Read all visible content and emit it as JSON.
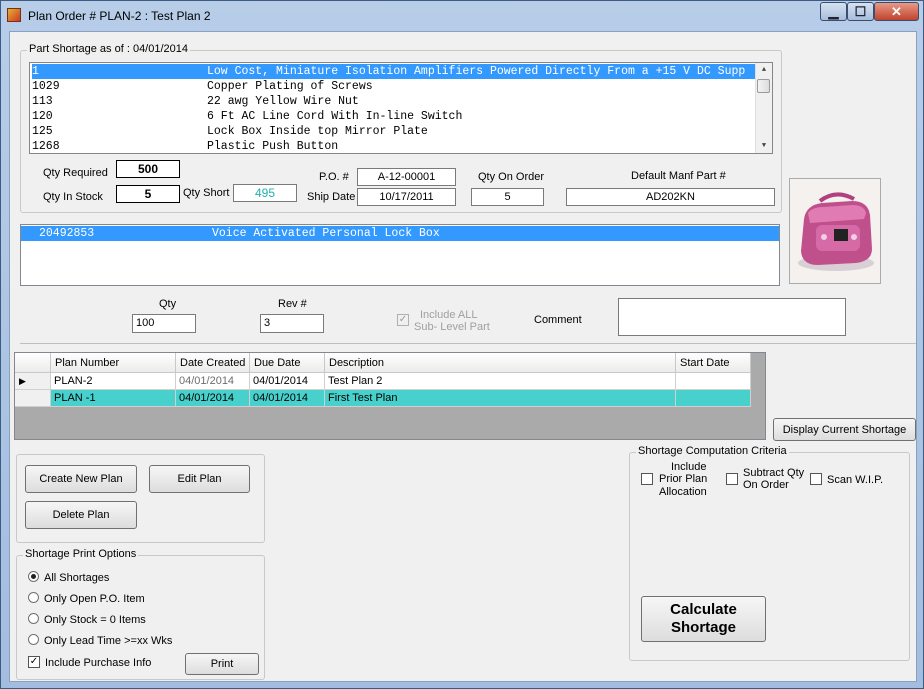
{
  "window": {
    "title": "Plan Order # PLAN-2 : Test Plan 2",
    "min_label": "▁",
    "max_label": "☐",
    "close_label": "✕"
  },
  "shortage_group": {
    "legend": "Part Shortage as of : 04/01/2014",
    "parts": [
      {
        "id": "1",
        "desc": "Low Cost, Miniature Isolation Amplifiers Powered Directly From a +15 V DC Supp",
        "selected": true
      },
      {
        "id": "1029",
        "desc": "Copper Plating of Screws",
        "selected": false
      },
      {
        "id": "113",
        "desc": "22 awg Yellow Wire Nut",
        "selected": false
      },
      {
        "id": "120",
        "desc": "6 Ft AC Line Cord With In-line Switch",
        "selected": false
      },
      {
        "id": "125",
        "desc": "Lock Box Inside top Mirror Plate",
        "selected": false
      },
      {
        "id": "1268",
        "desc": "Plastic Push Button",
        "selected": false
      }
    ],
    "qty_required_label": "Qty Required",
    "qty_required": "500",
    "qty_in_stock_label": "Qty In Stock",
    "qty_in_stock": "5",
    "qty_short_label": "Qty Short",
    "qty_short": "495",
    "po_label": "P.O. #",
    "po_value": "A-12-00001",
    "ship_date_label": "Ship Date",
    "ship_date": "10/17/2011",
    "qty_on_order_label": "Qty On Order",
    "qty_on_order": "5",
    "manf_part_label": "Default Manf Part #",
    "manf_part": "AD202KN"
  },
  "assembly_list": {
    "items": [
      {
        "id": "20492853",
        "desc": "Voice Activated Personal  Lock Box",
        "selected": true
      }
    ]
  },
  "plan_inputs": {
    "qty_label": "Qty",
    "qty_value": "100",
    "rev_label": "Rev #",
    "rev_value": "3",
    "include_all_label_1": "Include ALL",
    "include_all_label_2": "Sub- Level Part",
    "comment_label": "Comment",
    "comment_value": ""
  },
  "plans_grid": {
    "columns": [
      "Plan Number",
      "Date Created",
      "Due Date",
      "Description",
      "Start Date"
    ],
    "rows": [
      {
        "plan": "PLAN-2",
        "created": "04/01/2014",
        "due": "04/01/2014",
        "desc": "Test Plan 2",
        "start": "",
        "current": true,
        "selected": false
      },
      {
        "plan": "PLAN -1",
        "created": "04/01/2014",
        "due": "04/01/2014",
        "desc": "First Test Plan",
        "start": "",
        "current": false,
        "selected": true
      }
    ],
    "row_marker": "▶"
  },
  "buttons": {
    "display_current_shortage": "Display Current Shortage",
    "create_new_plan": "Create New  Plan",
    "edit_plan": "Edit Plan",
    "delete_plan": "Delete Plan",
    "print": "Print",
    "calculate_1": "Calculate",
    "calculate_2": "Shortage"
  },
  "print_options": {
    "legend": "Shortage Print Options",
    "options": [
      {
        "label": "All Shortages",
        "selected": true
      },
      {
        "label": "Only Open P.O. Item",
        "selected": false
      },
      {
        "label": "Only Stock = 0  Items",
        "selected": false
      },
      {
        "label": "Only Lead Time >=xx Wks",
        "selected": false
      }
    ],
    "include_purchase_info_label": "Include Purchase Info",
    "include_purchase_info": true
  },
  "criteria": {
    "legend": "Shortage Computation Criteria",
    "include_prior_1": "Include",
    "include_prior_2": "Prior Plan",
    "include_prior_3": "Allocation",
    "subtract_1": "Subtract Qty",
    "subtract_2": "On Order",
    "scan_wip": "Scan W.I.P."
  },
  "colors": {
    "selection": "#3399ff",
    "grid_selected": "#48d1cc",
    "qty_short_text": "#20b2aa"
  }
}
